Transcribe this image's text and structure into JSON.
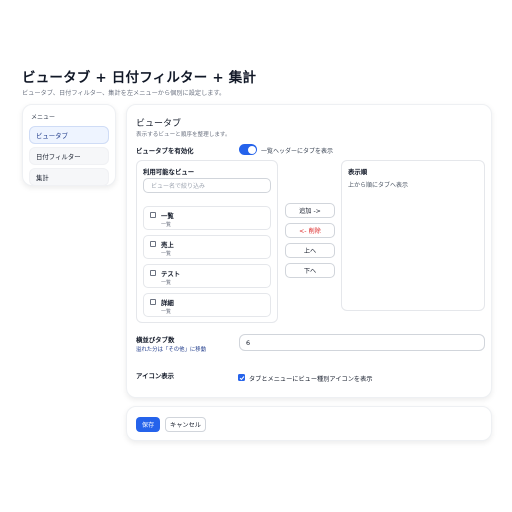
{
  "page": {
    "title": "ビュータブ + 日付フィルター + 集計",
    "subtitle": "ビュータブ、日付フィルター、集計を左メニューから個別に設定します。"
  },
  "sidebar": {
    "heading": "メニュー",
    "items": [
      {
        "label": "ビュータブ",
        "active": true
      },
      {
        "label": "日付フィルター",
        "active": false
      },
      {
        "label": "集計",
        "active": false
      }
    ]
  },
  "main": {
    "section_title": "ビュータブ",
    "section_desc": "表示するビューと順序を整理します。",
    "enable": {
      "label": "ビュータブを有効化",
      "toggle_on": true,
      "toggle_text": "一覧ヘッダーにタブを表示"
    },
    "available": {
      "title": "利用可能なビュー",
      "search_placeholder": "ビュー名で絞り込み",
      "items": [
        {
          "name": "一覧",
          "sub": "一覧",
          "checked": false
        },
        {
          "name": "売上",
          "sub": "一覧",
          "checked": false
        },
        {
          "name": "テスト",
          "sub": "一覧",
          "checked": false
        },
        {
          "name": "詳細",
          "sub": "一覧",
          "checked": false
        }
      ]
    },
    "actions": {
      "add": "追加 ->",
      "remove": "<- 削除",
      "up": "上へ",
      "down": "下へ"
    },
    "order": {
      "title": "表示順",
      "hint": "上から順にタブへ表示"
    },
    "tab_count": {
      "label": "横並びタブ数",
      "note": "溢れた分は「その他」に移動",
      "value": "6"
    },
    "icon_display": {
      "label": "アイコン表示",
      "checked": true,
      "checkbox_label": "タブとメニューにビュー種別アイコンを表示"
    }
  },
  "footer": {
    "save_label": "保存",
    "cancel_label": "キャンセル"
  },
  "colors": {
    "accent": "#2563eb",
    "danger": "#dc2626"
  }
}
